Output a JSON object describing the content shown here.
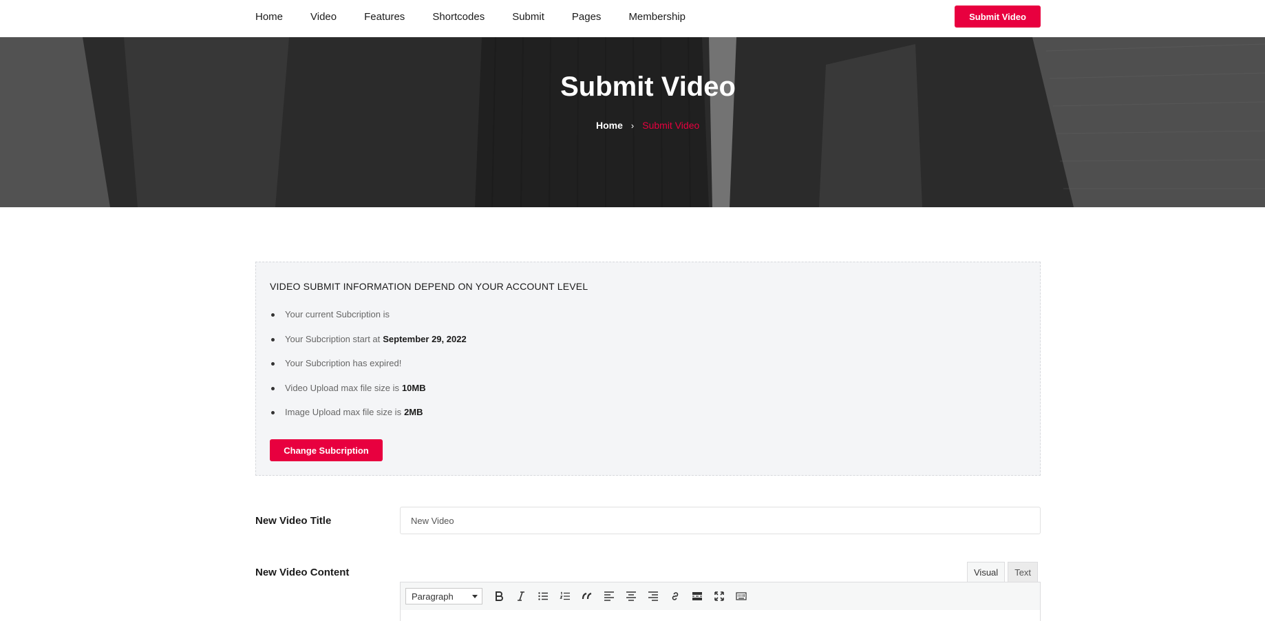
{
  "nav": {
    "links": [
      "Home",
      "Video",
      "Features",
      "Shortcodes",
      "Submit",
      "Pages",
      "Membership"
    ],
    "cta_label": "Submit Video"
  },
  "hero": {
    "title": "Submit Video",
    "breadcrumb": {
      "home": "Home",
      "current": "Submit Video"
    }
  },
  "info": {
    "heading": "VIDEO SUBMIT INFORMATION DEPEND ON YOUR ACCOUNT LEVEL",
    "items": [
      {
        "text": "Your current Subcription is",
        "value": ""
      },
      {
        "text": "Your Subcription start at",
        "value": "September 29, 2022"
      },
      {
        "text": "Your Subcription has expired!",
        "value": ""
      },
      {
        "text": "Video Upload max file size is",
        "value": "10MB"
      },
      {
        "text": "Image Upload max file size is",
        "value": "2MB"
      }
    ],
    "change_button": "Change Subcription"
  },
  "form": {
    "title_label": "New Video Title",
    "title_value": "New Video",
    "content_label": "New Video Content",
    "tabs": [
      "Visual",
      "Text"
    ],
    "format_value": "Paragraph",
    "toolbar_icons": [
      "bold-icon",
      "italic-icon",
      "bullet-list-icon",
      "numbered-list-icon",
      "blockquote-icon",
      "align-left-icon",
      "align-center-icon",
      "align-right-icon",
      "link-icon",
      "read-more-icon",
      "fullscreen-icon",
      "toolbar-toggle-icon"
    ]
  },
  "colors": {
    "accent": "#e8003f",
    "infobox_bg": "#f4f5f7"
  }
}
